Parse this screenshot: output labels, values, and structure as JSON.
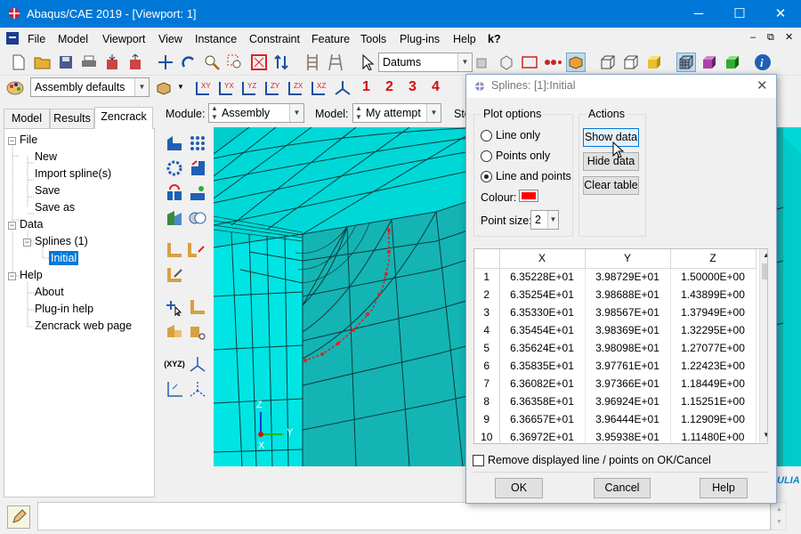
{
  "window": {
    "title": "Abaqus/CAE 2019 - [Viewport: 1]",
    "minimize": "─",
    "maximize": "☐",
    "close": "✕"
  },
  "menubar": {
    "items": [
      "File",
      "Model",
      "Viewport",
      "View",
      "Instance",
      "Constraint",
      "Feature",
      "Tools",
      "Plug-ins",
      "Help"
    ],
    "context_help": "k?"
  },
  "toolbar1": {
    "datums_label": "Datums"
  },
  "toolbar2": {
    "assembly_defaults": "Assembly defaults",
    "csys_numbers": [
      "1",
      "2",
      "3",
      "4"
    ]
  },
  "leftpanel": {
    "tabs": [
      "Model",
      "Results",
      "Zencrack"
    ],
    "active_tab": "Zencrack",
    "tree": {
      "file": "File",
      "file_items": [
        "New",
        "Import spline(s)",
        "Save",
        "Save as"
      ],
      "data": "Data",
      "splines": "Splines (1)",
      "initial": "Initial",
      "help": "Help",
      "help_items": [
        "About",
        "Plug-in help",
        "Zencrack web page"
      ]
    }
  },
  "modulebar": {
    "module_label": "Module:",
    "module_value": "Assembly",
    "model_label": "Model:",
    "model_value": "My attempt",
    "step_label": "Ste"
  },
  "viewport": {
    "triad": {
      "z": "Z",
      "y": "Y",
      "x": "X"
    },
    "brand": "ULIA",
    "colors": {
      "mesh": "#00cccc",
      "mesh_dark": "#16a8a8",
      "spline": "#e02020"
    }
  },
  "dialog": {
    "title": "Splines: [1]:Initial",
    "plot_options": {
      "label": "Plot options",
      "options": [
        "Line only",
        "Points only",
        "Line and points"
      ],
      "selected": "Line and points",
      "colour_label": "Colour:",
      "colour": "#ff0000",
      "point_size_label": "Point size:",
      "point_size": "2"
    },
    "actions": {
      "label": "Actions",
      "buttons": [
        "Show data",
        "Hide data",
        "Clear table"
      ]
    },
    "table": {
      "columns": [
        "X",
        "Y",
        "Z"
      ],
      "rows": [
        [
          "1",
          "6.35228E+01",
          "3.98729E+01",
          "1.50000E+00"
        ],
        [
          "2",
          "6.35254E+01",
          "3.98688E+01",
          "1.43899E+00"
        ],
        [
          "3",
          "6.35330E+01",
          "3.98567E+01",
          "1.37949E+00"
        ],
        [
          "4",
          "6.35454E+01",
          "3.98369E+01",
          "1.32295E+00"
        ],
        [
          "5",
          "6.35624E+01",
          "3.98098E+01",
          "1.27077E+00"
        ],
        [
          "6",
          "6.35835E+01",
          "3.97761E+01",
          "1.22423E+00"
        ],
        [
          "7",
          "6.36082E+01",
          "3.97366E+01",
          "1.18449E+00"
        ],
        [
          "8",
          "6.36358E+01",
          "3.96924E+01",
          "1.15251E+00"
        ],
        [
          "9",
          "6.36657E+01",
          "3.96444E+01",
          "1.12909E+00"
        ],
        [
          "10",
          "6.36972E+01",
          "3.95938E+01",
          "1.11480E+00"
        ]
      ]
    },
    "remove_checkbox": "Remove displayed line / points on OK/Cancel",
    "ok": "OK",
    "cancel": "Cancel",
    "help": "Help"
  }
}
